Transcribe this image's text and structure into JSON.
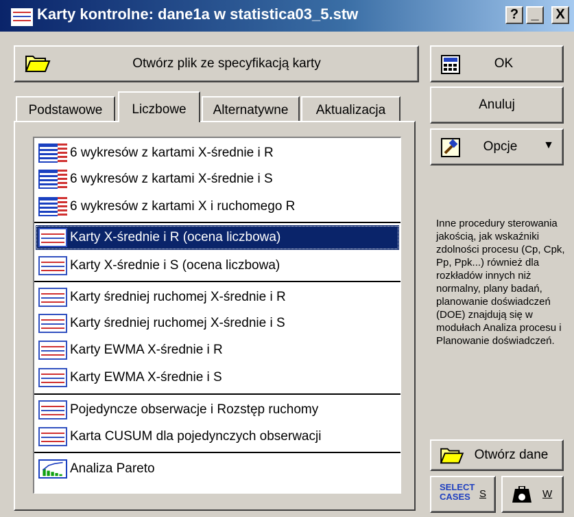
{
  "window": {
    "title": "Karty kontrolne: dane1a w statistica03_5.stw",
    "help_label": "?",
    "minimize_label": "_",
    "close_label": "X"
  },
  "open_spec_button": {
    "label": "Otwórz plik ze specyfikacją karty",
    "icon": "folder-open-icon"
  },
  "tabs": [
    {
      "label": "Podstawowe",
      "active": false
    },
    {
      "label": "Liczbowe",
      "active": true
    },
    {
      "label": "Alternatywne",
      "active": false
    },
    {
      "label": "Aktualizacja",
      "active": false
    }
  ],
  "list_items": [
    {
      "label": "6 wykresów z kartami X-średnie i R",
      "icon": "multi-chart-icon",
      "selected": false
    },
    {
      "label": "6 wykresów z kartami X-średnie i S",
      "icon": "multi-chart-icon",
      "selected": false
    },
    {
      "label": "6 wykresów z kartami X i ruchomego R",
      "icon": "multi-chart-icon",
      "selected": false
    },
    {
      "label": "Karty X-średnie i R (ocena liczbowa)",
      "icon": "control-chart-icon",
      "selected": true
    },
    {
      "label": "Karty X-średnie i S (ocena liczbowa)",
      "icon": "control-chart-icon",
      "selected": false
    },
    {
      "label": "Karty średniej ruchomej X-średnie i R",
      "icon": "control-chart-icon",
      "selected": false
    },
    {
      "label": "Karty średniej ruchomej X-średnie i S",
      "icon": "control-chart-icon",
      "selected": false
    },
    {
      "label": "Karty EWMA X-średnie i R",
      "icon": "control-chart-icon",
      "selected": false
    },
    {
      "label": "Karty EWMA X-średnie i S",
      "icon": "control-chart-icon",
      "selected": false
    },
    {
      "label": "Pojedyncze obserwacje i Rozstęp ruchomy",
      "icon": "control-chart-icon",
      "selected": false
    },
    {
      "label": "Karta CUSUM dla pojedynczych obserwacji",
      "icon": "control-chart-icon",
      "selected": false
    },
    {
      "label": "Analiza Pareto",
      "icon": "pareto-chart-icon",
      "selected": false
    }
  ],
  "buttons": {
    "ok": "OK",
    "cancel": "Anuluj",
    "options": "Opcje",
    "open_data": "Otwórz dane",
    "select_cases_top": "SELECT",
    "select_cases_bottom": "CASES",
    "select_cases_key": "S",
    "weight_key": "W"
  },
  "info_text": "Inne procedury sterowania jakością, jak wskaźniki zdolności procesu (Cp, Cpk, Pp, Ppk...) również dla rozkładów innych niż normalny, plany badań, planowanie doświadczeń (DOE) znajdują się w modułach Analiza procesu i Planowanie doświadczeń.",
  "colors": {
    "title_gradient_start": "#0a246a",
    "selection": "#0a246a",
    "face": "#d4d0c8"
  }
}
